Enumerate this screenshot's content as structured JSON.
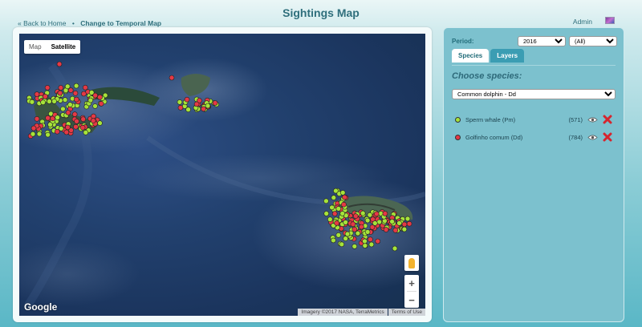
{
  "page": {
    "title": "Sightings Map"
  },
  "breadcrumb": {
    "back_label": "« Back to Home",
    "separator": "•",
    "current_label": "Change to Temporal Map"
  },
  "user": {
    "name": "Admin"
  },
  "map": {
    "type_buttons": [
      "Map",
      "Satellite"
    ],
    "active_type": "Satellite",
    "google_logo": "Google",
    "attribution": "Imagery ©2017 NASA, TerraMetrics",
    "terms": "Terms of Use",
    "zoom_in": "+",
    "zoom_out": "−"
  },
  "panel": {
    "period_label": "Period:",
    "year_value": "2016",
    "filter_value": "(All)",
    "tabs": [
      "Species",
      "Layers"
    ],
    "active_tab": "Species",
    "choose_label": "Choose species:",
    "species_select_value": "Common dolphin - Dd",
    "species_list": [
      {
        "name": "Sperm whale (Pm)",
        "count": "(571)",
        "color": "#a6e33a"
      },
      {
        "name": "Golfinho comum (Dd)",
        "count": "(784)",
        "color": "#e53945"
      }
    ]
  },
  "colors": {
    "green_marker": "#a6e33a",
    "red_marker": "#e53945",
    "panel_bg": "#7cc1ce"
  }
}
